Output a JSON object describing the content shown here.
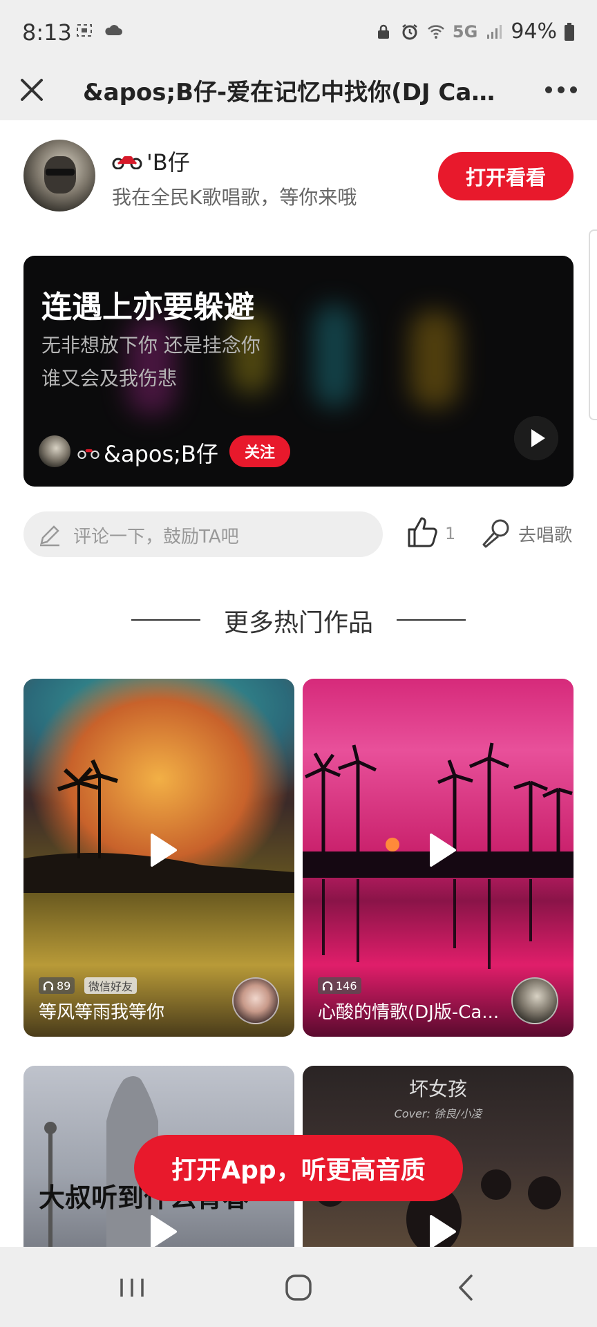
{
  "status_bar": {
    "time": "8:13",
    "network": "5G",
    "battery": "94%"
  },
  "nav": {
    "title": "&apos;B仔-爱在记忆中找你(DJ Cand..."
  },
  "author": {
    "name": "'B仔",
    "subtitle": "我在全民K歌唱歌，等你来哦",
    "open_button": "打开看看"
  },
  "lyric_card": {
    "title": "连遇上亦要躲避",
    "line1": "无非想放下你 还是挂念你",
    "line2": "谁又会及我伤悲",
    "user_name": "&apos;B仔",
    "follow_button": "关注"
  },
  "actions": {
    "comment_placeholder": "评论一下，鼓励TA吧",
    "like_count": "1",
    "sing_label": "去唱歌"
  },
  "section": {
    "title": "更多热门作品"
  },
  "works": [
    {
      "title": "等风等雨我等你",
      "plays": "89",
      "tag": "微信好友"
    },
    {
      "title": "心酸的情歌(DJ版-Ca...",
      "plays": "146"
    },
    {
      "title": "大叔听到什么青春"
    },
    {
      "title": "坏女孩",
      "caption": "Cover: 徐良/小凌"
    }
  ],
  "floating_button": {
    "label": "打开App，听更高音质"
  },
  "colors": {
    "accent": "#e8192c",
    "status_bar_bg": "#efefef"
  }
}
